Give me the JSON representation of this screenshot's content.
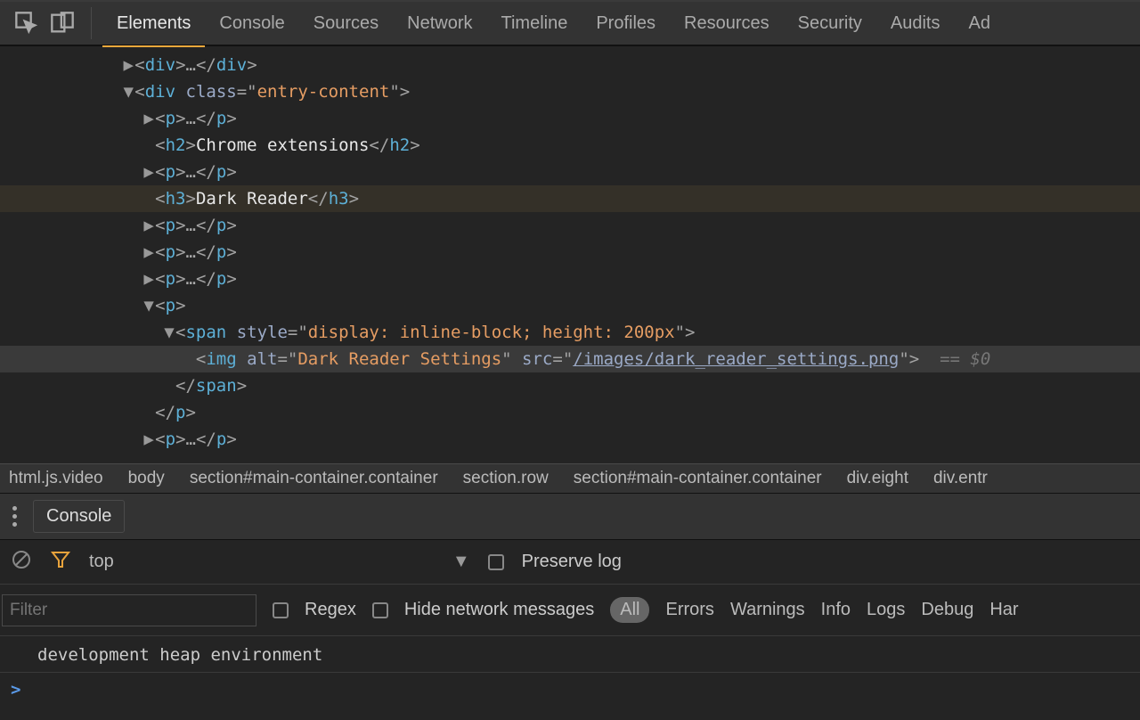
{
  "tabs": [
    "Elements",
    "Console",
    "Sources",
    "Network",
    "Timeline",
    "Profiles",
    "Resources",
    "Security",
    "Audits",
    "Ad"
  ],
  "active_tab": "Elements",
  "dom": {
    "ind0": "            ",
    "ind1": "              ",
    "ind2": "                ",
    "ind3": "                  ",
    "ind4": "                    ",
    "div": "div",
    "p": "p",
    "h2": "h2",
    "h3": "h3",
    "span": "span",
    "img": "img",
    "class_attr": "class",
    "style_attr": "style",
    "alt_attr": "alt",
    "src_attr": "src",
    "entry_content": "entry-content",
    "h2_text": "Chrome extensions",
    "h3_text": "Dark Reader",
    "span_style": "display: inline-block; height: 200px",
    "img_alt": "Dark Reader Settings",
    "img_src": "/images/dark_reader_settings.png",
    "sel": "== $0"
  },
  "breadcrumb": [
    "html.js.video",
    "body",
    "section#main-container.container",
    "section.row",
    "section#main-container.container",
    "div.eight",
    "div.entr"
  ],
  "drawer": {
    "tab": "Console"
  },
  "console_tb1": {
    "context": "top",
    "preserve": "Preserve log"
  },
  "console_tb2": {
    "filter_placeholder": "Filter",
    "regex": "Regex",
    "hide_net": "Hide network messages",
    "levels": [
      "All",
      "Errors",
      "Warnings",
      "Info",
      "Logs",
      "Debug",
      "Har"
    ]
  },
  "console_out": "development heap environment",
  "prompt": ">"
}
